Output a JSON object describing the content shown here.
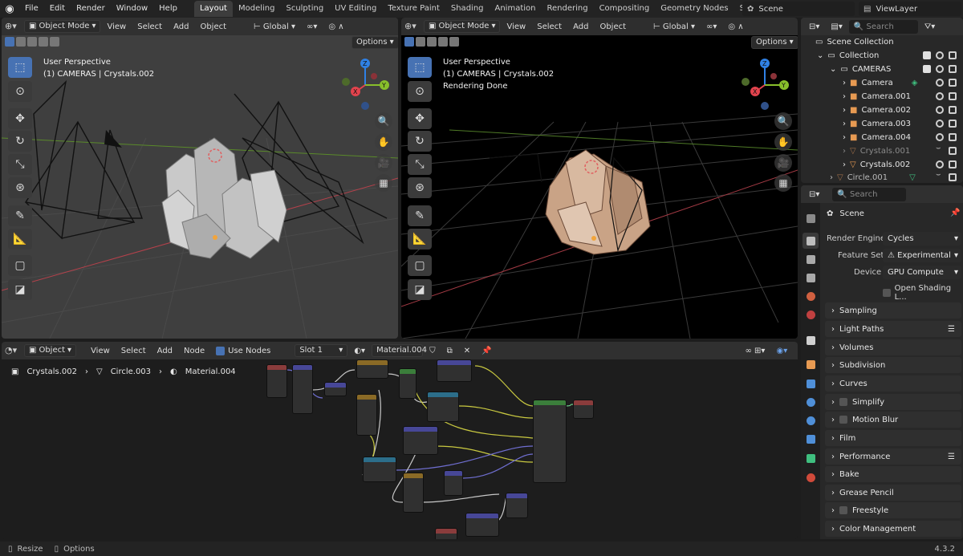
{
  "topbar": {
    "menus": [
      "File",
      "Edit",
      "Render",
      "Window",
      "Help"
    ],
    "workspaces": [
      "Layout",
      "Modeling",
      "Sculpting",
      "UV Editing",
      "Texture Paint",
      "Shading",
      "Animation",
      "Rendering",
      "Compositing",
      "Geometry Nodes",
      "Scripting"
    ],
    "active_workspace": "Layout",
    "add_tab": "+",
    "scene": "Scene",
    "view_layer": "ViewLayer"
  },
  "viewport_left": {
    "mode": "Object Mode",
    "menus": [
      "View",
      "Select",
      "Add",
      "Object"
    ],
    "orientation": "Global",
    "options": "Options",
    "overlay_line1": "User Perspective",
    "overlay_line2": "(1) CAMERAS | Crystals.002"
  },
  "viewport_right": {
    "mode": "Object Mode",
    "menus": [
      "View",
      "Select",
      "Add",
      "Object"
    ],
    "orientation": "Global",
    "options": "Options",
    "overlay_line1": "User Perspective",
    "overlay_line2": "(1) CAMERAS | Crystals.002",
    "overlay_line3": "Rendering Done"
  },
  "gizmo": {
    "z": "Z",
    "y": "Y",
    "x": "X"
  },
  "node_editor": {
    "type": "Object",
    "menus": [
      "View",
      "Select",
      "Add",
      "Node"
    ],
    "use_nodes": "Use Nodes",
    "slot": "Slot 1",
    "material": "Material.004",
    "breadcrumb": [
      "Crystals.002",
      "Circle.003",
      "Material.004"
    ]
  },
  "outliner": {
    "search_placeholder": "Search",
    "rows": [
      {
        "label": "Scene Collection"
      },
      {
        "label": "Collection"
      },
      {
        "label": "CAMERAS"
      },
      {
        "label": "Camera"
      },
      {
        "label": "Camera.001"
      },
      {
        "label": "Camera.002"
      },
      {
        "label": "Camera.003"
      },
      {
        "label": "Camera.004"
      },
      {
        "label": "Crystals.001"
      },
      {
        "label": "Crystals.002"
      },
      {
        "label": "Circle.001"
      }
    ]
  },
  "properties": {
    "search_placeholder": "Search",
    "context": "Scene",
    "render_engine_label": "Render Engine",
    "render_engine": "Cycles",
    "feature_set_label": "Feature Set",
    "feature_set": "Experimental",
    "device_label": "Device",
    "device": "GPU Compute",
    "open_shading": "Open Shading L...",
    "panels": [
      "Sampling",
      "Light Paths",
      "Volumes",
      "Subdivision",
      "Curves",
      "Simplify",
      "Motion Blur",
      "Film",
      "Performance",
      "Bake",
      "Grease Pencil",
      "Freestyle",
      "Color Management"
    ]
  },
  "statusbar": {
    "resize": "Resize",
    "options": "Options",
    "version": "4.3.2"
  },
  "colors": {
    "accent_blue": "#4772b3",
    "gizmo_x": "#e2434d",
    "gizmo_y": "#88bf2b",
    "gizmo_z": "#2f81e5"
  }
}
